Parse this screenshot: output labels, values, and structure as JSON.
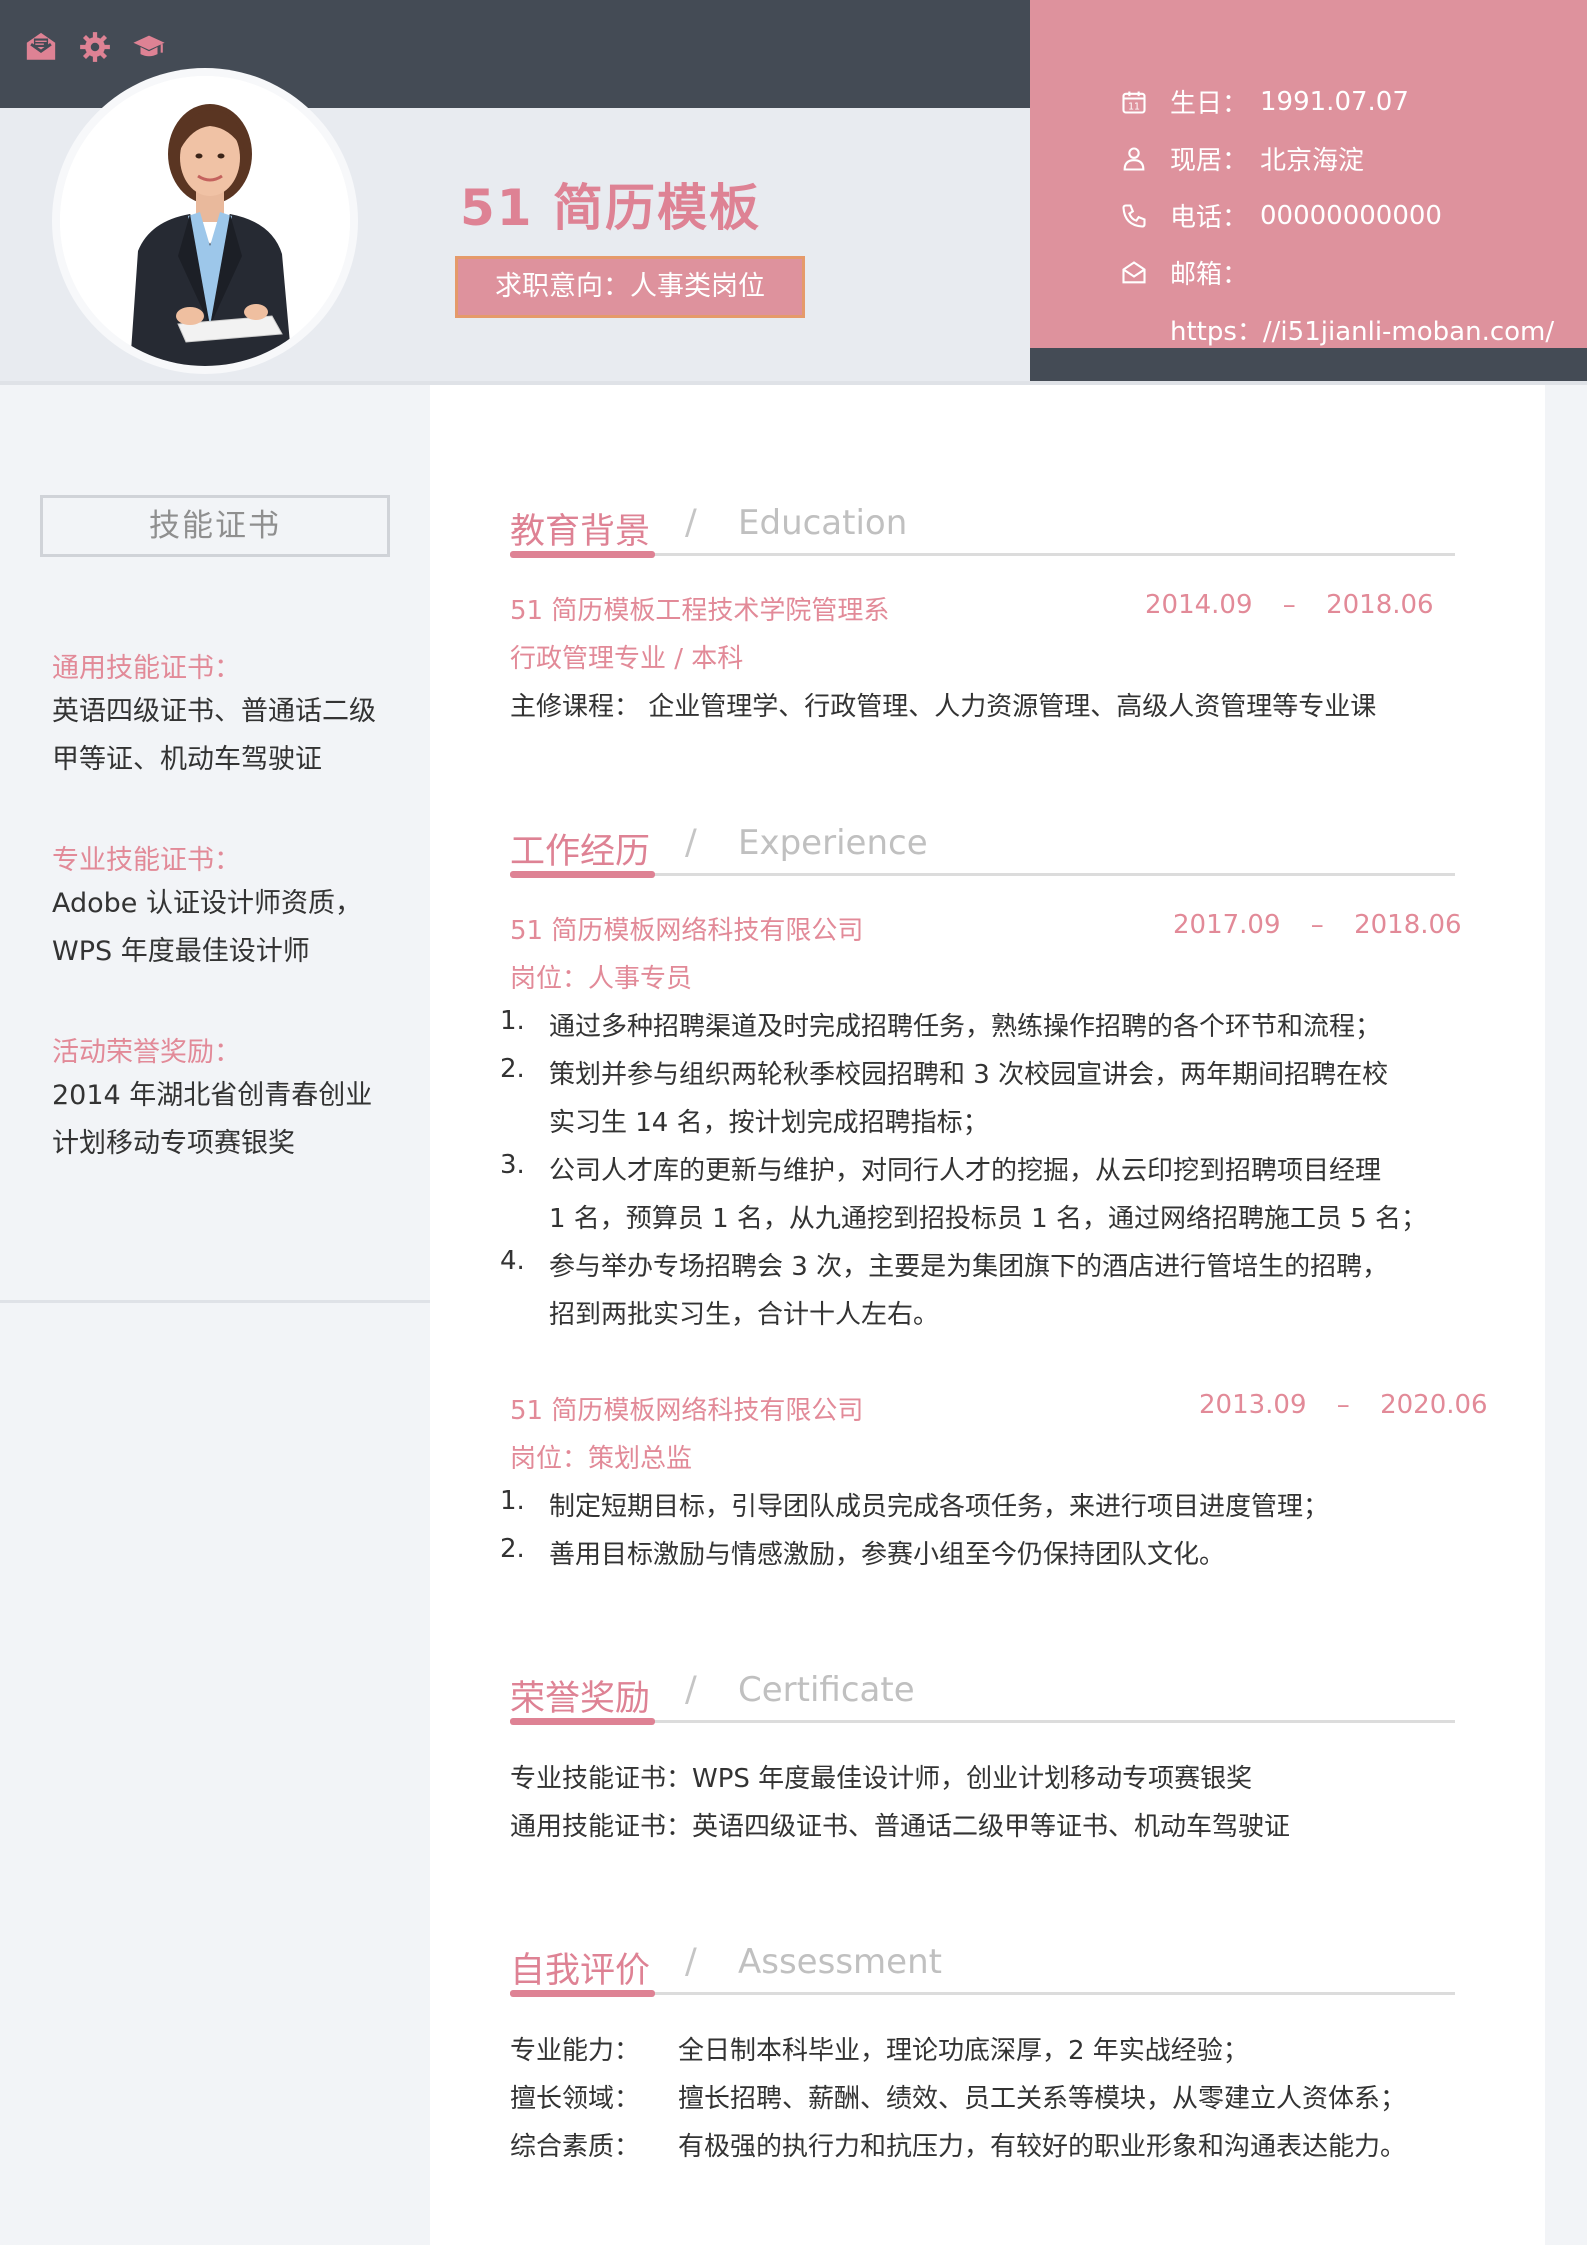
{
  "header": {
    "name": "51 简历模板",
    "intent": "求职意向：人事类岗位",
    "top_icons": [
      "mail-icon",
      "gear-icon",
      "graduation-cap-icon"
    ]
  },
  "contact": {
    "birthday_label": "生日：",
    "birthday": "1991.07.07",
    "location_label": "现居：",
    "location": "北京海淀",
    "phone_label": "电话：",
    "phone": "00000000000",
    "email_label": "邮箱：",
    "email": "https：//i51jianli-moban.com/"
  },
  "sidebar": {
    "title": "技能证书",
    "groups": [
      {
        "title": "通用技能证书：",
        "lines": [
          "英语四级证书、普通话二级",
          "甲等证、机动车驾驶证"
        ]
      },
      {
        "title": "专业技能证书：",
        "lines": [
          "Adobe 认证设计师资质，",
          "WPS 年度最佳设计师"
        ]
      },
      {
        "title": "活动荣誉奖励：",
        "lines": [
          "2014 年湖北省创青春创业",
          "计划移动专项赛银奖"
        ]
      }
    ]
  },
  "education": {
    "zh": "教育背景",
    "slash": "/",
    "en": "Education",
    "school": "51 简历模板工程技术学院管理系",
    "date_start": "2014.09",
    "date_sep": "–",
    "date_end": "2018.06",
    "major": "行政管理专业 / 本科",
    "courses": "主修课程：   企业管理学、行政管理、人力资源管理、高级人资管理等专业课"
  },
  "experience": {
    "zh": "工作经历",
    "slash": "/",
    "en": "Experience",
    "jobs": [
      {
        "company": "51 简历模板网络科技有限公司",
        "date_start": "2017.09",
        "date_sep": "–",
        "date_end": "2018.06",
        "role": "岗位：人事专员",
        "items": [
          {
            "n": "1.",
            "lines": [
              "通过多种招聘渠道及时完成招聘任务，熟练操作招聘的各个环节和流程；"
            ]
          },
          {
            "n": "2.",
            "lines": [
              "策划并参与组织两轮秋季校园招聘和 3 次校园宣讲会，两年期间招聘在校",
              "实习生 14 名，按计划完成招聘指标；"
            ]
          },
          {
            "n": "3.",
            "lines": [
              "公司人才库的更新与维护，对同行人才的挖掘，从云印挖到招聘项目经理",
              "1 名，预算员 1 名，从九通挖到招投标员 1 名，通过网络招聘施工员 5 名；"
            ]
          },
          {
            "n": "4.",
            "lines": [
              "参与举办专场招聘会 3 次，主要是为集团旗下的酒店进行管培生的招聘，",
              "招到两批实习生，合计十人左右。"
            ]
          }
        ]
      },
      {
        "company": "51 简历模板网络科技有限公司",
        "date_start": "2013.09",
        "date_sep": "–",
        "date_end": "2020.06",
        "role": "岗位：策划总监",
        "items": [
          {
            "n": "1.",
            "lines": [
              "制定短期目标，引导团队成员完成各项任务，来进行项目进度管理；"
            ]
          },
          {
            "n": "2.",
            "lines": [
              "善用目标激励与情感激励，参赛小组至今仍保持团队文化。"
            ]
          }
        ]
      }
    ]
  },
  "certificate": {
    "zh": "荣誉奖励",
    "slash": "/",
    "en": "Certificate",
    "lines": [
      "专业技能证书：WPS 年度最佳设计师，创业计划移动专项赛银奖",
      "通用技能证书：英语四级证书、普通话二级甲等证书、机动车驾驶证"
    ]
  },
  "assessment": {
    "zh": "自我评价",
    "slash": "/",
    "en": "Assessment",
    "rows": [
      {
        "label": "专业能力：",
        "text": "全日制本科毕业，理论功底深厚，2  年实战经验；"
      },
      {
        "label": "擅长领域：",
        "text": "擅长招聘、薪酬、绩效、员工关系等模块，从零建立人资体系；"
      },
      {
        "label": "综合素质：",
        "text": "有极强的执行力和抗压力，有较好的职业形象和沟通表达能力。"
      }
    ]
  },
  "colors": {
    "accent_pink": "#de8294",
    "header_dark": "#444b55",
    "contact_panel": "#de929d",
    "intent_border": "#e59a6a"
  }
}
